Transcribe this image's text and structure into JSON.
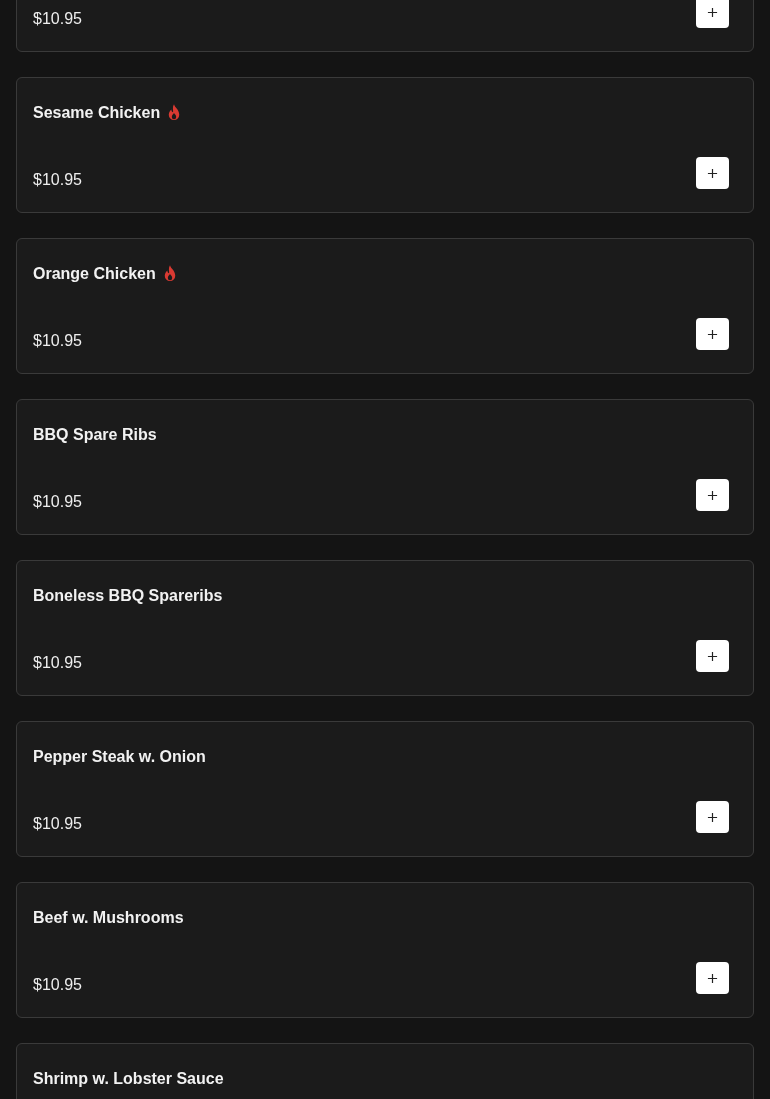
{
  "menu_items": [
    {
      "price": "$10.95"
    },
    {
      "name": "Sesame Chicken",
      "price": "$10.95",
      "spicy": true
    },
    {
      "name": "Orange Chicken",
      "price": "$10.95",
      "spicy": true
    },
    {
      "name": "BBQ Spare Ribs",
      "price": "$10.95",
      "spicy": false
    },
    {
      "name": "Boneless BBQ Spareribs",
      "price": "$10.95",
      "spicy": false
    },
    {
      "name": "Pepper Steak w. Onion",
      "price": "$10.95",
      "spicy": false
    },
    {
      "name": "Beef w. Mushrooms",
      "price": "$10.95",
      "spicy": false
    },
    {
      "name": "Shrimp w. Lobster Sauce",
      "spicy": false
    }
  ]
}
